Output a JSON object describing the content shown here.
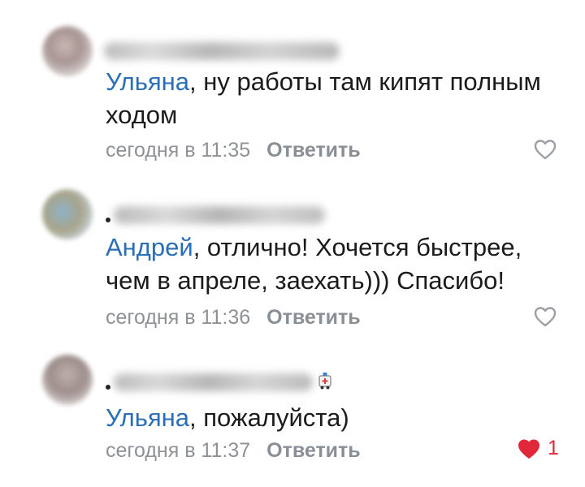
{
  "comments": [
    {
      "mention": "Ульяна",
      "text": ", ну работы там кипят полным ходом",
      "time": "сегодня в 11:35",
      "reply_label": "Ответить",
      "liked": false,
      "like_count": ""
    },
    {
      "mention": "Андрей",
      "text": ", отлично! Хочется быстрее, чем в апреле, заехать))) Спасибо!",
      "time": "сегодня в 11:36",
      "reply_label": "Ответить",
      "liked": false,
      "like_count": ""
    },
    {
      "mention": "Ульяна",
      "text": ", пожалуйста)",
      "time": "сегодня в 11:37",
      "reply_label": "Ответить",
      "liked": true,
      "like_count": "1"
    }
  ],
  "icons": {
    "like": "heart-outline-icon",
    "liked": "heart-filled-icon",
    "name_badge": "ambulance-icon"
  },
  "colors": {
    "mention": "#2a6fb6",
    "meta": "#8e9297",
    "heart_outline": "#9aa0a6",
    "heart_filled": "#e0283a"
  }
}
